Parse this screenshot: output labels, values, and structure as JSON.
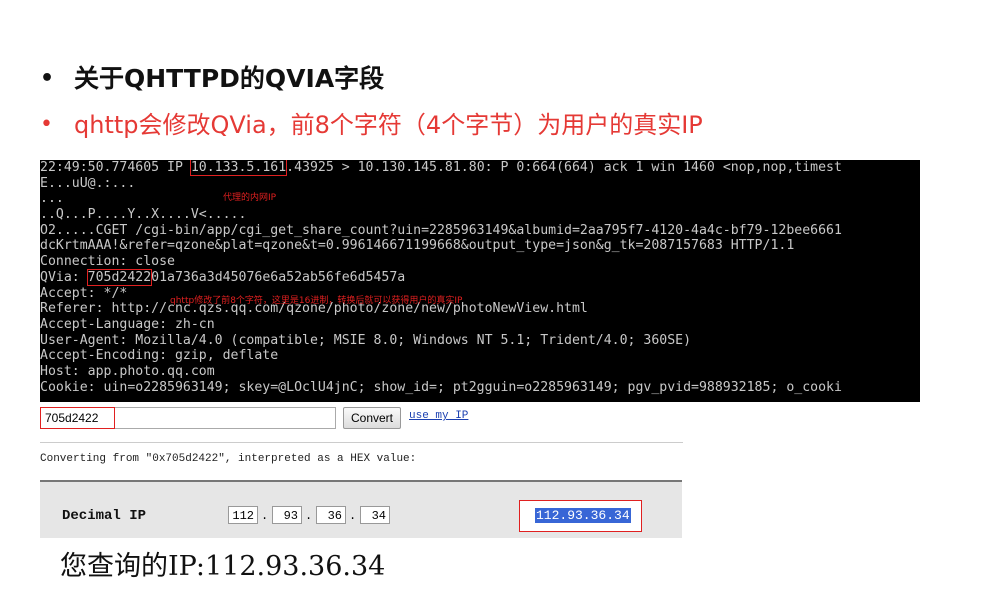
{
  "bullets": [
    {
      "marker": "•",
      "text": "关于QHTTPD的QVIA字段"
    },
    {
      "marker": "•",
      "text": "qhttp会修改QVia，前8个字符（4个字节）为用户的真实IP"
    }
  ],
  "terminal": {
    "line1_pre": "22:49:50.774605 IP ",
    "line1_ip": "10.133.5.161",
    "line1_post": ".43925 > 10.130.145.81.80: P 0:664(664) ack 1 win 1460 <nop,nop,timest",
    "line2": "E...uU@.:...",
    "line3": "...",
    "line4": "..Q...P....Y..X....V<.....",
    "line5": "O2.....CGET /cgi-bin/app/cgi_get_share_count?uin=2285963149&albumid=2aa795f7-4120-4a4c-bf79-12bee6661",
    "line6": "dcKrtmAAA!&refer=qzone&plat=qzone&t=0.996146671199668&output_type=json&g_tk=2087157683 HTTP/1.1",
    "line7": "Connection: close",
    "line8_pre": "QVia: ",
    "line8_hex": "705d2422",
    "line8_post": "01a736a3d45076e6a52ab56fe6d5457a",
    "line9": "Accept: */*",
    "line10": "Referer: http://cnc.qzs.qq.com/qzone/photo/zone/new/photoNewView.html",
    "line11": "Accept-Language: zh-cn",
    "line12": "User-Agent: Mozilla/4.0 (compatible; MSIE 8.0; Windows NT 5.1; Trident/4.0; 360SE)",
    "line13": "Accept-Encoding: gzip, deflate",
    "line14": "Host: app.photo.qq.com",
    "line15": "Cookie: uin=o2285963149; skey=@LOclU4jnC; show_id=; pt2gguin=o2285963149; pgv_pvid=988932185; o_cooki",
    "note_ip": "代理的内网IP",
    "note_qvia": "qhttp修改了前8个字符，这里是16进制，转换后就可以获得用户的真实IP"
  },
  "converter": {
    "input_value": "705d2422",
    "convert_label": "Convert",
    "use_my_ip_label": "use my IP",
    "converting_text": "Converting from \"0x705d2422\", interpreted as a HEX value:",
    "decimal_label": "Decimal IP",
    "octets": [
      "112",
      "93",
      "36",
      "34"
    ],
    "result_ip": "112.93.36.34"
  },
  "query_result": "您查询的IP:112.93.36.34",
  "colors": {
    "accent_red": "#e53935",
    "terminal_bg": "#000000",
    "selection_blue": "#3866d6"
  }
}
